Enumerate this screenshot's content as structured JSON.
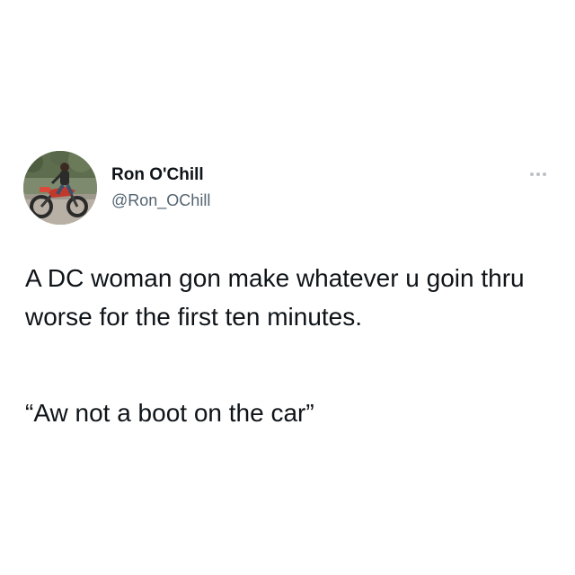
{
  "user": {
    "display_name": "Ron O'Chill",
    "handle": "@Ron_OChill",
    "avatar_icon": "profile-photo-motorcycle-rider"
  },
  "tweet": {
    "text_paragraph_1": "A DC woman gon make whatever u goin thru worse for the first ten minutes.",
    "text_paragraph_2": "“Aw not a boot on the car”"
  },
  "more_menu_icon": "more-options-icon",
  "colors": {
    "text_primary": "#0f1419",
    "text_secondary": "#536471",
    "background": "#ffffff",
    "menu_dots": "#b9c1c7"
  }
}
